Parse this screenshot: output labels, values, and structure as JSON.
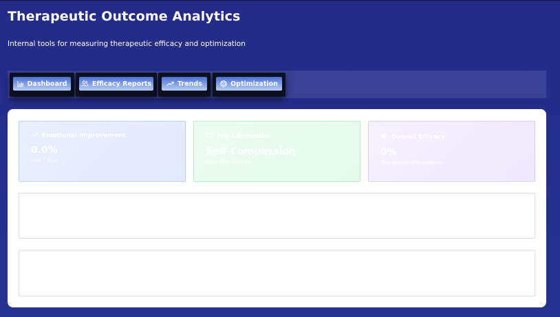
{
  "header": {
    "title": "Therapeutic Outcome Analytics",
    "subtitle": "Internal tools for measuring therapeutic efficacy and optimization"
  },
  "tabs": [
    {
      "label": "Dashboard",
      "icon": "bar-chart-icon"
    },
    {
      "label": "Efficacy Reports",
      "icon": "users-icon"
    },
    {
      "label": "Trends",
      "icon": "trending-up-icon"
    },
    {
      "label": "Optimization",
      "icon": "target-icon"
    }
  ],
  "stats": [
    {
      "label": "Emotional Improvement",
      "value": "0.0%",
      "note": "Last 7 days",
      "icon": "trending-up-icon",
      "accent": "#e2e9fd"
    },
    {
      "label": "Top Affirmation",
      "value": "Self-Compassion",
      "note": "Most effective type",
      "icon": "heart-icon",
      "accent": "#e4fbec"
    },
    {
      "label": "Overall Efficacy",
      "value": "0%",
      "note": "Therapeutic effectiveness",
      "icon": "brain-icon",
      "accent": "#efe8fd"
    }
  ],
  "colors": {
    "background": "#253090",
    "tab_gradient_top": "#4a6fd6",
    "tab_gradient_bottom": "#b8cdf5"
  }
}
